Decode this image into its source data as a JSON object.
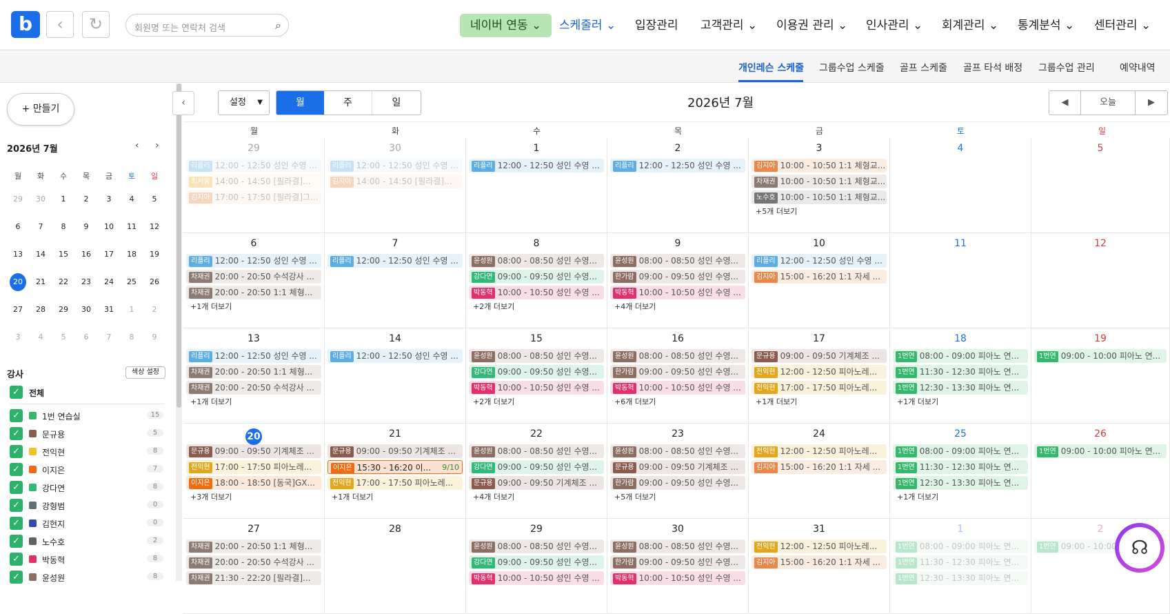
{
  "top": {
    "search_placeholder": "회원명 또는 연락처 검색",
    "menus": [
      {
        "label": "네이버 연동 ⌄",
        "style": "naver"
      },
      {
        "label": "스케줄러 ⌄",
        "style": "active"
      },
      {
        "label": "입장관리",
        "style": ""
      },
      {
        "label": "고객관리 ⌄",
        "style": ""
      },
      {
        "label": "이용권 관리 ⌄",
        "style": ""
      },
      {
        "label": "인사관리 ⌄",
        "style": ""
      },
      {
        "label": "회계관리 ⌄",
        "style": ""
      },
      {
        "label": "통계분석 ⌄",
        "style": ""
      },
      {
        "label": "센터관리 ⌄",
        "style": ""
      }
    ]
  },
  "subtabs": [
    "개인레슨 스케줄",
    "그룹수업 스케줄",
    "골프 스케줄",
    "골프 타석 배정",
    "그룹수업 관리",
    "예약내역"
  ],
  "sidebar": {
    "make_label": "+ 만들기",
    "mini_title": "2026년 7월",
    "weekdays": [
      "월",
      "화",
      "수",
      "목",
      "금",
      "토",
      "일"
    ],
    "days": [
      29,
      30,
      1,
      2,
      3,
      4,
      5,
      6,
      7,
      8,
      9,
      10,
      11,
      12,
      13,
      14,
      15,
      16,
      17,
      18,
      19,
      20,
      21,
      22,
      23,
      24,
      25,
      26,
      27,
      28,
      29,
      30,
      31,
      1,
      2,
      3,
      4,
      5,
      6,
      7,
      8,
      9
    ],
    "section_title": "강사",
    "color_btn": "색상 설정",
    "all_label": "전체",
    "instructors": [
      {
        "name": "1번 연습실",
        "count": "15",
        "color": "#35b86b"
      },
      {
        "name": "문규용",
        "count": "5",
        "color": "#8a5c4e"
      },
      {
        "name": "전익현",
        "count": "8",
        "color": "#f2c027"
      },
      {
        "name": "이지은",
        "count": "7",
        "color": "#ee6d12"
      },
      {
        "name": "강다연",
        "count": "8",
        "color": "#33b87a"
      },
      {
        "name": "강형범",
        "count": "0",
        "color": "#5e7078"
      },
      {
        "name": "김현지",
        "count": "0",
        "color": "#3949ab"
      },
      {
        "name": "노수호",
        "count": "2",
        "color": "#616161"
      },
      {
        "name": "박동혁",
        "count": "8",
        "color": "#e0316b"
      },
      {
        "name": "윤성원",
        "count": "8",
        "color": "#8d6e63"
      }
    ]
  },
  "calendar": {
    "setting": "설정",
    "views": [
      "월",
      "주",
      "일"
    ],
    "title": "2026년 7월",
    "today_btn": "오늘",
    "weekdays": [
      "월",
      "화",
      "수",
      "목",
      "금",
      "토",
      "일"
    ],
    "weeks": [
      [
        {
          "d": "29",
          "muted": true,
          "events": [
            {
              "t": "리플리",
              "c": "#5dade2",
              "x": "12:00 - 12:50 성인 수영 ...",
              "f": true
            },
            {
              "t": "최서웅",
              "c": "#f0b23a",
              "x": "14:00 - 14:50 [필라결]...",
              "f": true
            },
            {
              "t": "김지아",
              "c": "#e8884a",
              "x": "17:00 - 17:50 [필라결]그...",
              "f": true
            }
          ],
          "more": ""
        },
        {
          "d": "30",
          "muted": true,
          "events": [
            {
              "t": "리플리",
              "c": "#5dade2",
              "x": "12:00 - 12:50 성인 수영 ...",
              "f": true
            },
            {
              "t": "김지아",
              "c": "#e8884a",
              "x": "14:00 - 14:50 [필라결]...",
              "f": true
            }
          ],
          "more": ""
        },
        {
          "d": "1",
          "events": [
            {
              "t": "리플리",
              "c": "#5dade2",
              "x": "12:00 - 12:50 성인 수영 ..."
            }
          ],
          "more": ""
        },
        {
          "d": "2",
          "events": [
            {
              "t": "리플리",
              "c": "#5dade2",
              "x": "12:00 - 12:50 성인 수영 ..."
            }
          ],
          "more": ""
        },
        {
          "d": "3",
          "events": [
            {
              "t": "김지아",
              "c": "#e8884a",
              "x": "10:00 - 10:50 1:1 체형교..."
            },
            {
              "t": "차재권",
              "c": "#8c7b72",
              "x": "10:00 - 10:50 1:1 체형교..."
            },
            {
              "t": "노수호",
              "c": "#757575",
              "x": "10:00 - 10:50 1:1 체형교..."
            }
          ],
          "more": "+5개 더보기"
        },
        {
          "d": "4",
          "sat": true,
          "events": [],
          "more": ""
        },
        {
          "d": "5",
          "sun": true,
          "events": [],
          "more": ""
        }
      ],
      [
        {
          "d": "6",
          "events": [
            {
              "t": "리플리",
              "c": "#5dade2",
              "x": "12:00 - 12:50 성인 수영 ..."
            },
            {
              "t": "차재권",
              "c": "#8c7b72",
              "x": "20:00 - 20:50 수석강사 ..."
            },
            {
              "t": "차재권",
              "c": "#8c7b72",
              "x": "20:00 - 20:50 1:1 체형..."
            }
          ],
          "more": "+1개 더보기"
        },
        {
          "d": "7",
          "events": [
            {
              "t": "리플리",
              "c": "#5dade2",
              "x": "12:00 - 12:50 성인 수영 ..."
            }
          ],
          "more": ""
        },
        {
          "d": "8",
          "events": [
            {
              "t": "윤성원",
              "c": "#8d6e63",
              "x": "08:00 - 08:50 성인 수영..."
            },
            {
              "t": "강다연",
              "c": "#33b87a",
              "x": "09:00 - 09:50 성인 수영..."
            },
            {
              "t": "박동혁",
              "c": "#e0316b",
              "x": "10:00 - 10:50 성인 수영 ..."
            }
          ],
          "more": "+2개 더보기"
        },
        {
          "d": "9",
          "events": [
            {
              "t": "윤성원",
              "c": "#8d6e63",
              "x": "08:00 - 08:50 성인 수영..."
            },
            {
              "t": "한가람",
              "c": "#8d6e63",
              "x": "09:00 - 09:50 성인 수영..."
            },
            {
              "t": "박동혁",
              "c": "#e0316b",
              "x": "10:00 - 10:50 성인 수영 ..."
            }
          ],
          "more": "+4개 더보기"
        },
        {
          "d": "10",
          "events": [
            {
              "t": "리플리",
              "c": "#5dade2",
              "x": "12:00 - 12:50 성인 수영 ..."
            },
            {
              "t": "김지아",
              "c": "#e8884a",
              "x": "15:00 - 16:20 1:1 자세 ..."
            }
          ],
          "more": ""
        },
        {
          "d": "11",
          "sat": true,
          "events": [],
          "more": ""
        },
        {
          "d": "12",
          "sun": true,
          "events": [],
          "more": ""
        }
      ],
      [
        {
          "d": "13",
          "events": [
            {
              "t": "리플리",
              "c": "#5dade2",
              "x": "12:00 - 12:50 성인 수영 ..."
            },
            {
              "t": "차재권",
              "c": "#8c7b72",
              "x": "20:00 - 20:50 1:1 체형..."
            },
            {
              "t": "차재권",
              "c": "#8c7b72",
              "x": "20:00 - 20:50 수석강사 ..."
            }
          ],
          "more": "+1개 더보기"
        },
        {
          "d": "14",
          "events": [
            {
              "t": "리플리",
              "c": "#5dade2",
              "x": "12:00 - 12:50 성인 수영 ..."
            }
          ],
          "more": ""
        },
        {
          "d": "15",
          "events": [
            {
              "t": "윤성원",
              "c": "#8d6e63",
              "x": "08:00 - 08:50 성인 수영..."
            },
            {
              "t": "강다연",
              "c": "#33b87a",
              "x": "09:00 - 09:50 성인 수영..."
            },
            {
              "t": "박동혁",
              "c": "#e0316b",
              "x": "10:00 - 10:50 성인 수영 ..."
            }
          ],
          "more": "+2개 더보기"
        },
        {
          "d": "16",
          "events": [
            {
              "t": "윤성원",
              "c": "#8d6e63",
              "x": "08:00 - 08:50 성인 수영..."
            },
            {
              "t": "한가람",
              "c": "#8d6e63",
              "x": "09:00 - 09:50 성인 수영..."
            },
            {
              "t": "박동혁",
              "c": "#e0316b",
              "x": "10:00 - 10:50 성인 수영 ..."
            }
          ],
          "more": "+6개 더보기"
        },
        {
          "d": "17",
          "events": [
            {
              "t": "문규용",
              "c": "#8a5c4e",
              "x": "09:00 - 09:50 기계체조 ..."
            },
            {
              "t": "전익현",
              "c": "#e0a820",
              "x": "12:00 - 12:50 피아노레..."
            },
            {
              "t": "전익현",
              "c": "#e0a820",
              "x": "17:00 - 17:50 피아노레..."
            }
          ],
          "more": "+1개 더보기"
        },
        {
          "d": "18",
          "sat": true,
          "events": [
            {
              "t": "1번연",
              "c": "#35b86b",
              "x": "08:00 - 09:00 피아노 연..."
            },
            {
              "t": "1번연",
              "c": "#35b86b",
              "x": "11:30 - 12:30 피아노 연..."
            },
            {
              "t": "1번연",
              "c": "#35b86b",
              "x": "12:30 - 13:30 피아노 연..."
            }
          ],
          "more": "+1개 더보기"
        },
        {
          "d": "19",
          "sun": true,
          "events": [
            {
              "t": "1번연",
              "c": "#35b86b",
              "x": "09:00 - 10:00 피아노 연..."
            }
          ],
          "more": ""
        }
      ],
      [
        {
          "d": "20",
          "today": true,
          "events": [
            {
              "t": "문규용",
              "c": "#8a5c4e",
              "x": "09:00 - 09:50 기계체조 ..."
            },
            {
              "t": "전익현",
              "c": "#e0a820",
              "x": "17:00 - 17:50 피아노레..."
            },
            {
              "t": "이지은",
              "c": "#ee6d12",
              "x": "18:00 - 18:50 [동국]GX..."
            }
          ],
          "more": "+3개 더보기"
        },
        {
          "d": "21",
          "events": [
            {
              "t": "문규용",
              "c": "#8a5c4e",
              "x": "09:00 - 09:50 기계체조 ..."
            },
            {
              "t": "이지은",
              "c": "#ee6d12",
              "x": "15:30 - 16:20 이...",
              "hl": true,
              "cnt": "9/10"
            },
            {
              "t": "전익현",
              "c": "#e0a820",
              "x": "17:00 - 17:50 피아노레..."
            }
          ],
          "more": "+1개 더보기"
        },
        {
          "d": "22",
          "events": [
            {
              "t": "윤성원",
              "c": "#8d6e63",
              "x": "08:00 - 08:50 성인 수영..."
            },
            {
              "t": "강다연",
              "c": "#33b87a",
              "x": "09:00 - 09:50 성인 수영..."
            },
            {
              "t": "문규용",
              "c": "#8a5c4e",
              "x": "09:00 - 09:50 기계체조 ..."
            }
          ],
          "more": "+4개 더보기"
        },
        {
          "d": "23",
          "events": [
            {
              "t": "윤성원",
              "c": "#8d6e63",
              "x": "08:00 - 08:50 성인 수영..."
            },
            {
              "t": "문규용",
              "c": "#8a5c4e",
              "x": "09:00 - 09:50 기계체조 ..."
            },
            {
              "t": "한가람",
              "c": "#8d6e63",
              "x": "09:00 - 09:50 성인 수영..."
            }
          ],
          "more": "+5개 더보기"
        },
        {
          "d": "24",
          "events": [
            {
              "t": "전익현",
              "c": "#e0a820",
              "x": "12:00 - 12:50 피아노레..."
            },
            {
              "t": "김지아",
              "c": "#e8884a",
              "x": "15:00 - 16:20 1:1 자세 ..."
            }
          ],
          "more": ""
        },
        {
          "d": "25",
          "sat": true,
          "events": [
            {
              "t": "1번연",
              "c": "#35b86b",
              "x": "08:00 - 09:00 피아노 연..."
            },
            {
              "t": "1번연",
              "c": "#35b86b",
              "x": "11:30 - 12:30 피아노 연..."
            },
            {
              "t": "1번연",
              "c": "#35b86b",
              "x": "12:30 - 13:30 피아노 연..."
            }
          ],
          "more": "+1개 더보기"
        },
        {
          "d": "26",
          "sun": true,
          "events": [
            {
              "t": "1번연",
              "c": "#35b86b",
              "x": "09:00 - 10:00 피아노 연..."
            }
          ],
          "more": ""
        }
      ],
      [
        {
          "d": "27",
          "events": [
            {
              "t": "차재권",
              "c": "#8c7b72",
              "x": "20:00 - 20:50 1:1 체형..."
            },
            {
              "t": "차재권",
              "c": "#8c7b72",
              "x": "20:00 - 20:50 수석강사 ..."
            },
            {
              "t": "차재권",
              "c": "#8c7b72",
              "x": "21:30 - 22:20 [필라결]..."
            }
          ],
          "more": ""
        },
        {
          "d": "28",
          "events": [],
          "more": ""
        },
        {
          "d": "29",
          "events": [
            {
              "t": "윤성원",
              "c": "#8d6e63",
              "x": "08:00 - 08:50 성인 수영..."
            },
            {
              "t": "강다연",
              "c": "#33b87a",
              "x": "09:00 - 09:50 성인 수영..."
            },
            {
              "t": "박동혁",
              "c": "#e0316b",
              "x": "10:00 - 10:50 성인 수영 ..."
            }
          ],
          "more": ""
        },
        {
          "d": "30",
          "events": [
            {
              "t": "윤성원",
              "c": "#8d6e63",
              "x": "08:00 - 08:50 성인 수영..."
            },
            {
              "t": "한가람",
              "c": "#8d6e63",
              "x": "09:00 - 09:50 성인 수영..."
            },
            {
              "t": "박동혁",
              "c": "#e0316b",
              "x": "10:00 - 10:50 성인 수영 ..."
            }
          ],
          "more": ""
        },
        {
          "d": "31",
          "events": [
            {
              "t": "전익현",
              "c": "#e0a820",
              "x": "12:00 - 12:50 피아노레..."
            },
            {
              "t": "김지아",
              "c": "#e8884a",
              "x": "15:00 - 16:20 1:1 자세 ..."
            }
          ],
          "more": ""
        },
        {
          "d": "1",
          "sat": true,
          "muted": true,
          "events": [
            {
              "t": "1번연",
              "c": "#35b86b",
              "x": "08:00 - 09:00 피아노 연...",
              "f": true
            },
            {
              "t": "1번연",
              "c": "#35b86b",
              "x": "11:30 - 12:30 피아노 연...",
              "f": true
            },
            {
              "t": "1번연",
              "c": "#35b86b",
              "x": "12:30 - 13:30 피아노 연...",
              "f": true
            }
          ],
          "more": ""
        },
        {
          "d": "2",
          "sun": true,
          "muted": true,
          "events": [
            {
              "t": "1번연",
              "c": "#35b86b",
              "x": "09:00 - 10:00 피아노 연...",
              "f": true
            }
          ],
          "more": ""
        }
      ]
    ]
  }
}
